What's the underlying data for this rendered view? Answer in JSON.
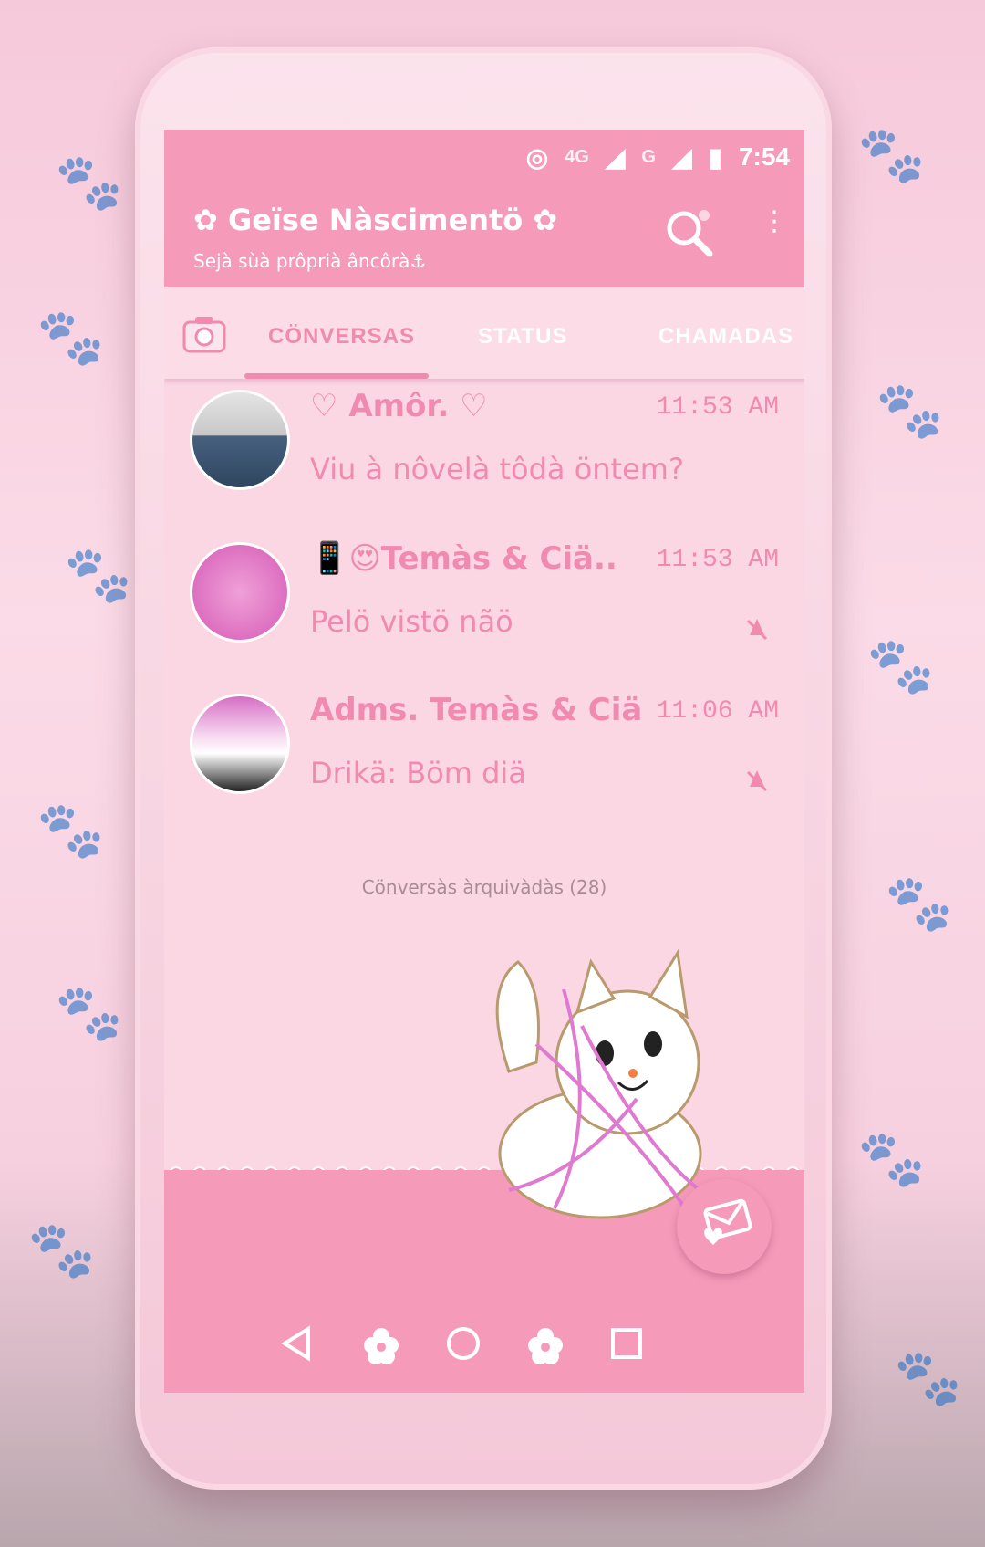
{
  "status_bar": {
    "network_primary": "4G",
    "network_secondary": "G",
    "time": "7:54"
  },
  "header": {
    "title": "✿ Geïse Nàscimentö ✿",
    "subtitle": "Sejà sùà prôprià âncôrà⚓"
  },
  "tabs": [
    {
      "label": "CÖNVERSAS",
      "active": true
    },
    {
      "label": "STATUS",
      "active": false
    },
    {
      "label": "CHAMADAS",
      "active": false
    }
  ],
  "chats": [
    {
      "name": "♡ Amôr. ♡",
      "time": "11:53 AM",
      "message": "Viu à nôvelà tôdà öntem?",
      "muted": false
    },
    {
      "name": "📱😍Temàs & Ciä..",
      "time": "11:53 AM",
      "message": "Pelö vistö nãö",
      "muted": true
    },
    {
      "name": "Adms. Temàs & Ciä",
      "time": "11:06 AM",
      "message": "Drikä: Böm diä",
      "muted": true
    }
  ],
  "archived_label": "Cönversàs àrquivàdàs (28)",
  "colors": {
    "primary": "#f59ab9",
    "accent": "#f08aae",
    "background": "#fbd6e3"
  },
  "icons": [
    "search-icon",
    "menu-icon",
    "camera-icon",
    "mute-icon",
    "message-heart-icon",
    "back-icon",
    "home-icon",
    "recents-icon",
    "flower-icon"
  ]
}
